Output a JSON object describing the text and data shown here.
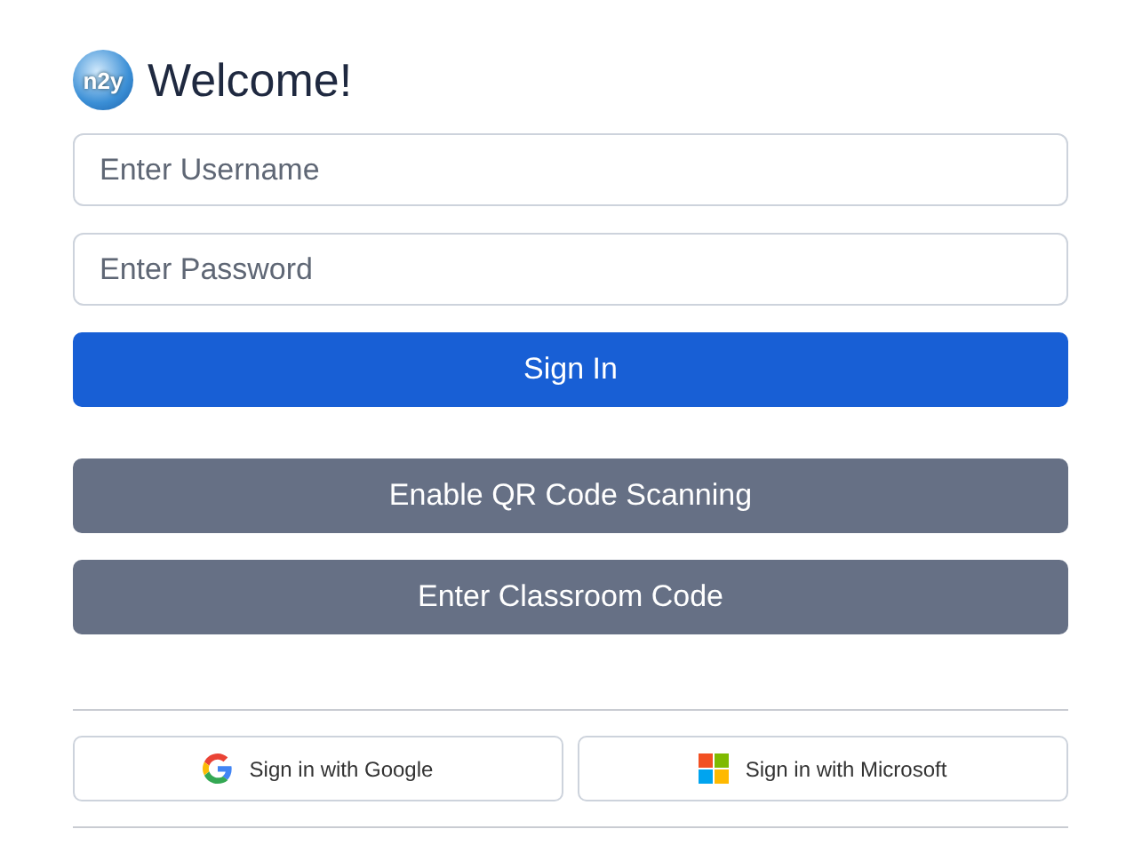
{
  "header": {
    "logo_text": "n2y",
    "title": "Welcome!"
  },
  "fields": [
    {
      "placeholder": "Enter Username"
    },
    {
      "placeholder": "Enter Password"
    }
  ],
  "buttons": [
    {
      "label": "Sign In",
      "kind": "primary"
    },
    {
      "label": "Enable QR Code Scanning",
      "kind": "secondary"
    },
    {
      "label": "Enter Classroom Code",
      "kind": "secondary"
    }
  ],
  "social": [
    {
      "label": "Sign in with Google",
      "kind": "google"
    },
    {
      "label": "Sign in with Microsoft",
      "kind": "microsoft"
    }
  ]
}
